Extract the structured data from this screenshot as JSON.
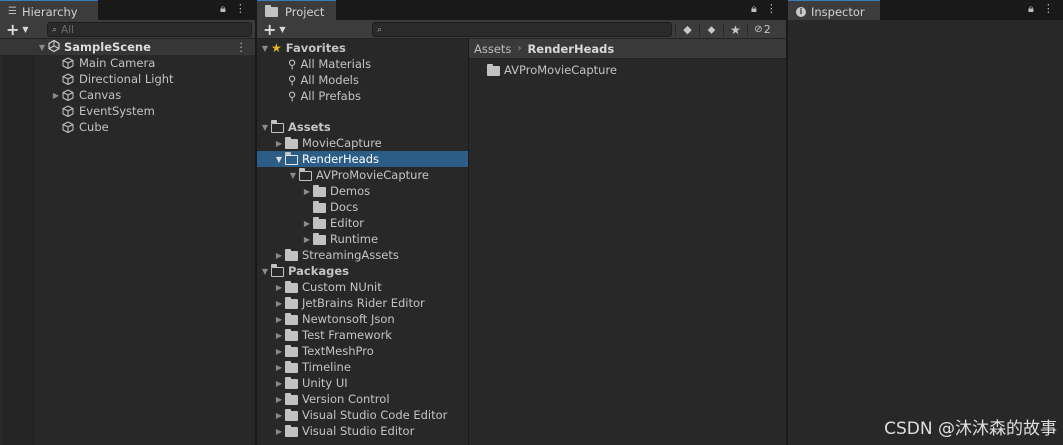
{
  "hierarchy": {
    "tab_label": "Hierarchy",
    "search_placeholder": "All",
    "scene_name": "SampleScene",
    "items": [
      "Main Camera",
      "Directional Light",
      "Canvas",
      "EventSystem",
      "Cube"
    ]
  },
  "project": {
    "tab_label": "Project",
    "hidden_packages_count": "2",
    "favorites_label": "Favorites",
    "favorites": [
      "All Materials",
      "All Models",
      "All Prefabs"
    ],
    "assets_label": "Assets",
    "assets": {
      "movie_capture": "MovieCapture",
      "render_heads": "RenderHeads",
      "av_pro": "AVProMovieCapture",
      "demos": "Demos",
      "docs": "Docs",
      "editor": "Editor",
      "runtime": "Runtime",
      "streaming_assets": "StreamingAssets"
    },
    "packages_label": "Packages",
    "packages": [
      "Custom NUnit",
      "JetBrains Rider Editor",
      "Newtonsoft Json",
      "Test Framework",
      "TextMeshPro",
      "Timeline",
      "Unity UI",
      "Version Control",
      "Visual Studio Code Editor",
      "Visual Studio Editor"
    ],
    "breadcrumb": [
      "Assets",
      "RenderHeads"
    ],
    "content_items": [
      "AVProMovieCapture"
    ]
  },
  "inspector": {
    "tab_label": "Inspector"
  },
  "watermark": "CSDN @沐沐森的故事",
  "colors": {
    "selection": "#2c5d87",
    "active_tab_accent": "#3a79bb",
    "favorites_star": "#e6b422"
  }
}
